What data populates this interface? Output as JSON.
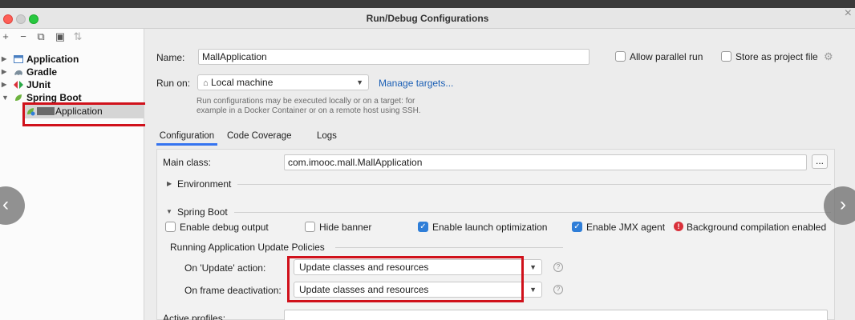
{
  "window": {
    "title": "Run/Debug Configurations"
  },
  "toolbar": {
    "add": "+",
    "remove": "−",
    "copy": "⧉",
    "folder": "▣",
    "sort": "⇅"
  },
  "tree": [
    {
      "label": "Application",
      "icon": "application-icon",
      "expanded": false
    },
    {
      "label": "Gradle",
      "icon": "gradle-icon",
      "expanded": false
    },
    {
      "label": "JUnit",
      "icon": "junit-icon",
      "expanded": false
    },
    {
      "label": "Spring Boot",
      "icon": "spring-boot-icon",
      "expanded": true
    },
    {
      "label": "Application",
      "icon": "spring-app-icon",
      "selected": true
    }
  ],
  "form": {
    "name_label": "Name:",
    "name_value": "MallApplication",
    "allow_parallel": "Allow parallel run",
    "store_project": "Store as project file",
    "run_on_label": "Run on:",
    "run_on_value": "Local machine",
    "manage_targets": "Manage targets...",
    "hint_line1": "Run configurations may be executed locally or on a target: for",
    "hint_line2": "example in a Docker Container or on a remote host using SSH."
  },
  "tabs": [
    "Configuration",
    "Code Coverage",
    "Logs"
  ],
  "config": {
    "main_class_label": "Main class:",
    "main_class_value": "com.imooc.mall.MallApplication",
    "browse": "...",
    "environment": "Environment",
    "spring_boot": "Spring Boot",
    "enable_debug": "Enable debug output",
    "hide_banner": "Hide banner",
    "enable_launch": "Enable launch optimization",
    "enable_jmx": "Enable JMX agent",
    "bg_compilation": "Background compilation enabled",
    "policies_title": "Running Application Update Policies",
    "on_update_label": "On 'Update' action:",
    "on_update_value": "Update classes and resources",
    "on_frame_label": "On frame deactivation:",
    "on_frame_value": "Update classes and resources",
    "help": "?",
    "active_profiles_label": "Active profiles:",
    "active_profiles_value": ""
  },
  "checks": {
    "allow_parallel": false,
    "store_project": false,
    "enable_debug": false,
    "hide_banner": false,
    "enable_launch": true,
    "enable_jmx": true
  },
  "nav": {
    "prev": "‹",
    "next": "›"
  },
  "colors": {
    "highlight": "#d0111b",
    "accent": "#3574f0",
    "link": "#1b5fb5",
    "error": "#d9303a"
  }
}
